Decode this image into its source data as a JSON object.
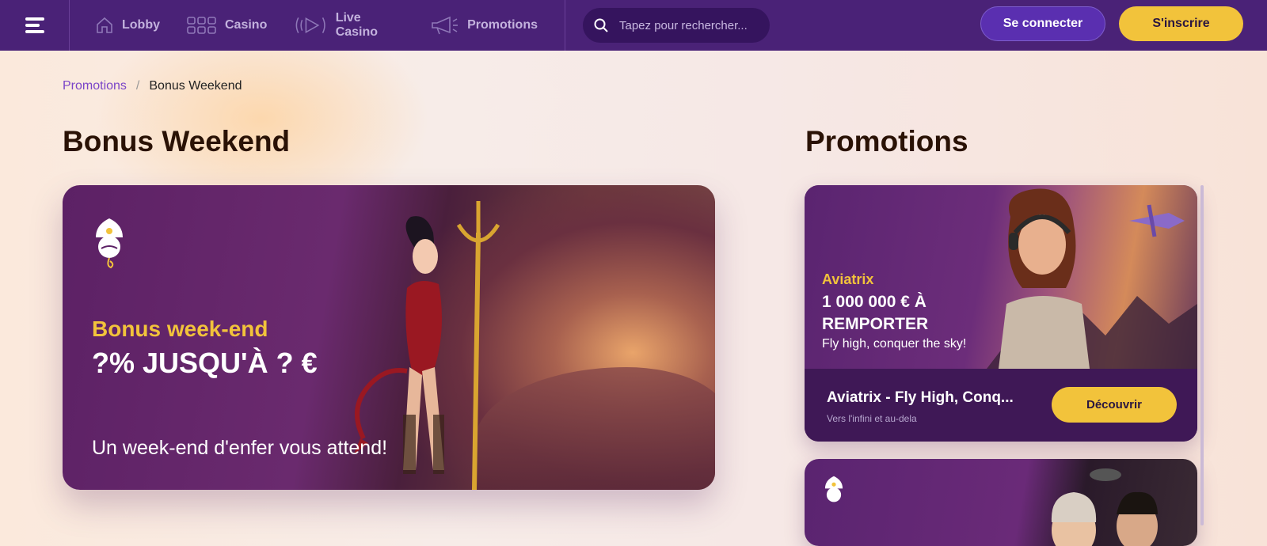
{
  "nav": {
    "items": [
      {
        "label": "Lobby",
        "icon": "home-icon"
      },
      {
        "label": "Casino",
        "icon": "grid-icon"
      },
      {
        "label": "Live Casino",
        "icon": "play-icon"
      },
      {
        "label": "Promotions",
        "icon": "megaphone-icon"
      }
    ],
    "search_placeholder": "Tapez pour rechercher...",
    "login_label": "Se connecter",
    "signup_label": "S'inscrire"
  },
  "breadcrumb": {
    "parent": "Promotions",
    "separator": "/",
    "current": "Bonus Weekend"
  },
  "page_title": "Bonus Weekend",
  "banner": {
    "title": "Bonus week-end",
    "amount": "?% JUSQU'À ? €",
    "subtitle": "Un week-end d'enfer vous attend!"
  },
  "sidebar": {
    "title": "Promotions",
    "cards": [
      {
        "art_name": "Aviatrix",
        "art_headline": "1 000 000 € À REMPORTER",
        "art_tagline": "Fly high, conquer the sky!",
        "title": "Aviatrix - Fly High, Conq...",
        "description": "Vers l'infini et au-dela",
        "button_label": "Découvrir"
      }
    ]
  },
  "colors": {
    "header": "#4a2277",
    "accent": "#f2c33b",
    "primary": "#5a2fb0",
    "link": "#7b45c8"
  }
}
